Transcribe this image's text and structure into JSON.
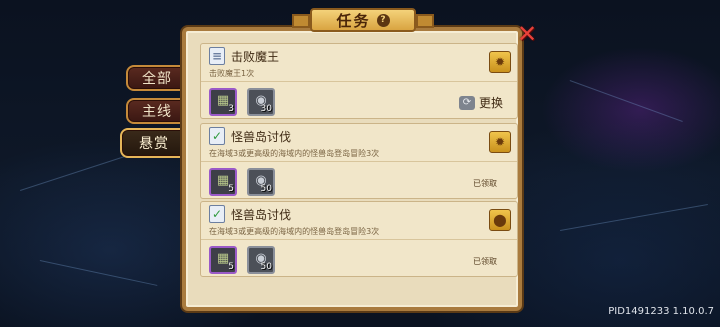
{
  "header": {
    "title": "任务",
    "help_icon": "question-icon",
    "close_icon": "close-icon"
  },
  "sidebar": {
    "tabs": [
      {
        "label": "全部",
        "active": false
      },
      {
        "label": "主线",
        "active": false
      },
      {
        "label": "悬赏",
        "active": true
      }
    ]
  },
  "tasks": [
    {
      "title": "击败魔王",
      "description": "击败魔王1次",
      "icon": "clipboard-icon",
      "badge_icon": "gear-badge-icon",
      "rewards": [
        {
          "icon": "item-icon",
          "qty": "3"
        },
        {
          "icon": "coin-icon",
          "qty": "30"
        }
      ],
      "action_label": "更换",
      "action_icon": "swap-icon"
    },
    {
      "title": "怪兽岛讨伐",
      "description": "在海域3或更高级的海域内的怪兽岛登岛冒险3次",
      "icon": "checked-clipboard-icon",
      "badge_icon": "gear-badge-icon",
      "rewards": [
        {
          "icon": "item-icon",
          "qty": "5"
        },
        {
          "icon": "coin-icon",
          "qty": "50"
        }
      ],
      "status": "已领取"
    },
    {
      "title": "怪兽岛讨伐",
      "description": "在海域3或更高级的海域内的怪兽岛登岛冒险3次",
      "icon": "checked-clipboard-icon",
      "badge_icon": "location-pin-icon",
      "rewards": [
        {
          "icon": "item-icon",
          "qty": "5"
        },
        {
          "icon": "coin-icon",
          "qty": "50"
        }
      ],
      "status": "已领取"
    }
  ],
  "footer": {
    "build_id": "PID1491233 1.10.0.7"
  },
  "colors": {
    "panel_bg": "#e9dcbc",
    "frame": "#a97b3e",
    "close_red": "#e8413a",
    "badge_gold": "#f0c44b"
  }
}
